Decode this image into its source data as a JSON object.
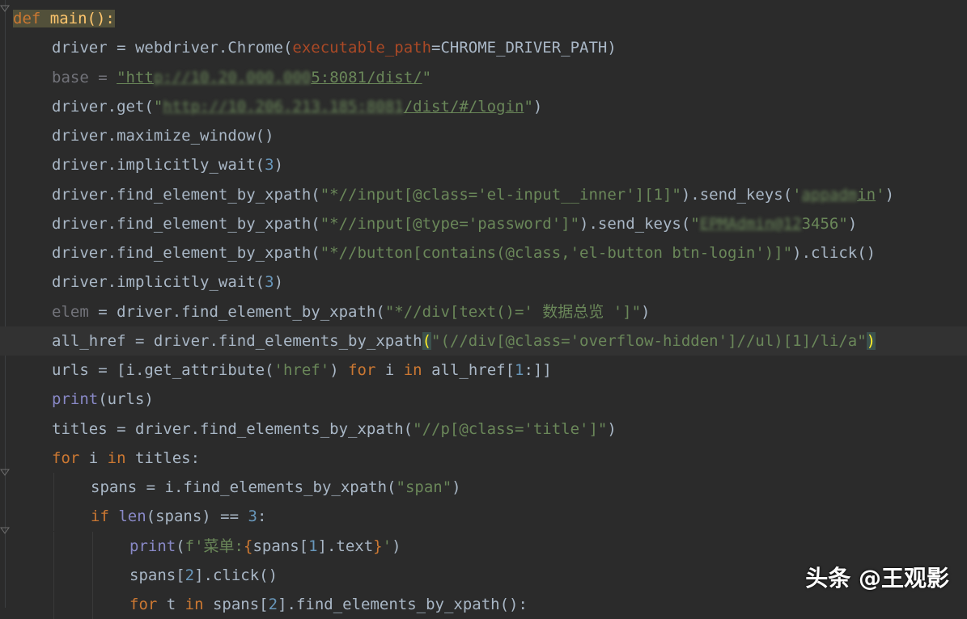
{
  "editor": {
    "lines": [
      {
        "indent": 0,
        "tokens": [
          {
            "t": "def",
            "c": "kw def-hl"
          },
          {
            "t": " main():",
            "c": "fn def-hl"
          }
        ]
      },
      {
        "indent": 1,
        "tokens": [
          {
            "t": "driver = webdriver.Chrome("
          },
          {
            "t": "executable_path",
            "c": "param"
          },
          {
            "t": "=CHROME_DRIVER_PATH)"
          }
        ]
      },
      {
        "indent": 1,
        "tokens": [
          {
            "t": "base",
            "c": "unused"
          },
          {
            "t": " = ",
            "c": "unused"
          },
          {
            "t": "\"htt",
            "c": "str ul"
          },
          {
            "t": "p://10.2",
            "c": "blur"
          },
          {
            "t": "0.000.000",
            "c": "blur"
          },
          {
            "t": "5:8081/dist/",
            "c": "str ul"
          },
          {
            "t": "\"",
            "c": "str"
          }
        ]
      },
      {
        "indent": 1,
        "tokens": [
          {
            "t": "driver.get("
          },
          {
            "t": "\"",
            "c": "str"
          },
          {
            "t": "http://10.206.213.185:8081",
            "c": "blur"
          },
          {
            "t": "/dist/#/login",
            "c": "str ul"
          },
          {
            "t": "\"",
            "c": "str"
          },
          {
            "t": ")"
          }
        ]
      },
      {
        "indent": 1,
        "tokens": [
          {
            "t": "driver.maximize_window()"
          }
        ]
      },
      {
        "indent": 1,
        "tokens": [
          {
            "t": "driver.implicitly_wait("
          },
          {
            "t": "3",
            "c": "num"
          },
          {
            "t": ")"
          }
        ]
      },
      {
        "indent": 1,
        "tokens": [
          {
            "t": "driver.find_element_by_xpath("
          },
          {
            "t": "\"*//input[@class='el-input__inner'][1]\"",
            "c": "str"
          },
          {
            "t": ").send_keys("
          },
          {
            "t": "'",
            "c": "str"
          },
          {
            "t": "appadm",
            "c": "blur"
          },
          {
            "t": "in",
            "c": "str ul"
          },
          {
            "t": "'",
            "c": "str"
          },
          {
            "t": ")"
          }
        ]
      },
      {
        "indent": 1,
        "tokens": [
          {
            "t": "driver.find_element_by_xpath("
          },
          {
            "t": "\"*//input[@type='password']\"",
            "c": "str"
          },
          {
            "t": ").send_keys("
          },
          {
            "t": "\"",
            "c": "str"
          },
          {
            "t": "EPMAdmin@12",
            "c": "blur"
          },
          {
            "t": "3456\"",
            "c": "str"
          },
          {
            "t": ")"
          }
        ]
      },
      {
        "indent": 1,
        "tokens": [
          {
            "t": "driver.find_element_by_xpath("
          },
          {
            "t": "\"*//button[contains(@class,'el-button btn-login')]\"",
            "c": "str"
          },
          {
            "t": ").click()"
          }
        ]
      },
      {
        "indent": 1,
        "tokens": [
          {
            "t": "driver.implicitly_wait("
          },
          {
            "t": "3",
            "c": "num"
          },
          {
            "t": ")"
          }
        ]
      },
      {
        "indent": 1,
        "tokens": [
          {
            "t": "elem",
            "c": "unused"
          },
          {
            "t": " = driver.find_element_by_xpath("
          },
          {
            "t": "\"*//div[text()=' 数据总览 ']\"",
            "c": "str"
          },
          {
            "t": ")"
          }
        ]
      },
      {
        "indent": 1,
        "current": true,
        "tokens": [
          {
            "t": "all_href = driver.find_elements_by_xpath"
          },
          {
            "t": "(",
            "c": "brace-hl"
          },
          {
            "t": "\"(//div[@class='overflow-hidden']//ul)[1]/li/a\"",
            "c": "str"
          },
          {
            "t": ")",
            "c": "brace-hl"
          }
        ]
      },
      {
        "indent": 1,
        "tokens": [
          {
            "t": "urls = [i.get_attribute("
          },
          {
            "t": "'href'",
            "c": "str"
          },
          {
            "t": ") "
          },
          {
            "t": "for",
            "c": "kw"
          },
          {
            "t": " i "
          },
          {
            "t": "in",
            "c": "kw"
          },
          {
            "t": " all_href["
          },
          {
            "t": "1",
            "c": "num"
          },
          {
            "t": ":]]"
          }
        ]
      },
      {
        "indent": 1,
        "tokens": [
          {
            "t": "print",
            "c": "builtin"
          },
          {
            "t": "(urls)"
          }
        ]
      },
      {
        "indent": 1,
        "tokens": [
          {
            "t": "titles = driver.find_elements_by_xpath("
          },
          {
            "t": "\"//p[@class='title']\"",
            "c": "str"
          },
          {
            "t": ")"
          }
        ]
      },
      {
        "indent": 1,
        "tokens": [
          {
            "t": "for",
            "c": "kw"
          },
          {
            "t": " i "
          },
          {
            "t": "in",
            "c": "kw"
          },
          {
            "t": " titles:"
          }
        ]
      },
      {
        "indent": 2,
        "tokens": [
          {
            "t": "spans = i.find_elements_by_xpath("
          },
          {
            "t": "\"span\"",
            "c": "str"
          },
          {
            "t": ")"
          }
        ]
      },
      {
        "indent": 2,
        "tokens": [
          {
            "t": "if",
            "c": "kw"
          },
          {
            "t": " "
          },
          {
            "t": "len",
            "c": "builtin"
          },
          {
            "t": "(spans) == "
          },
          {
            "t": "3",
            "c": "num"
          },
          {
            "t": ":"
          }
        ]
      },
      {
        "indent": 3,
        "tokens": [
          {
            "t": "print",
            "c": "builtin"
          },
          {
            "t": "("
          },
          {
            "t": "f'菜单:",
            "c": "str"
          },
          {
            "t": "{",
            "c": "kw"
          },
          {
            "t": "spans["
          },
          {
            "t": "1",
            "c": "num"
          },
          {
            "t": "].text"
          },
          {
            "t": "}",
            "c": "kw"
          },
          {
            "t": "'",
            "c": "str"
          },
          {
            "t": ")"
          }
        ]
      },
      {
        "indent": 3,
        "tokens": [
          {
            "t": "spans["
          },
          {
            "t": "2",
            "c": "num"
          },
          {
            "t": "].click()"
          }
        ]
      },
      {
        "indent": 3,
        "tokens": [
          {
            "t": "for",
            "c": "kw"
          },
          {
            "t": " t "
          },
          {
            "t": "in",
            "c": "kw"
          },
          {
            "t": " spans["
          },
          {
            "t": "2",
            "c": "num"
          },
          {
            "t": "].find_elements_by_xpath():"
          }
        ]
      }
    ]
  },
  "watermark": "头条 @王观影",
  "colors": {
    "background": "#2b2b2b",
    "keyword": "#cc7832",
    "function": "#ffc66d",
    "string": "#6a8759",
    "number": "#6897bb",
    "param": "#aa4926",
    "builtin": "#8888c6"
  }
}
